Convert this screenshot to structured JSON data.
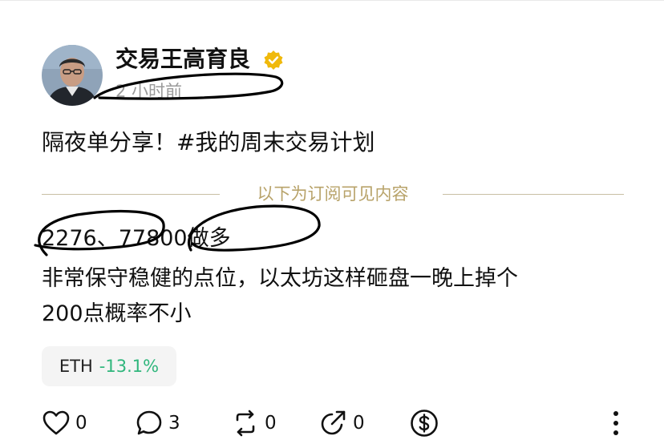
{
  "post": {
    "author": "交易王高育良",
    "timestamp": "2 小时前",
    "title": "隔夜单分享！#我的周末交易计划",
    "divider_text": "以下为订阅可见内容",
    "body_lines": [
      "2276、77800做多",
      "非常保守稳健的点位，以太坊这样砸盘一晚上掉个",
      "200点概率不小"
    ]
  },
  "ticker": {
    "symbol": "ETH",
    "change": "-13.1%"
  },
  "actions": {
    "likes": "0",
    "comments": "3",
    "reposts": "0",
    "shares": "0"
  },
  "colors": {
    "ticker_change": "#2fb67c",
    "divider_text": "#b8a36a",
    "verified_badge": "#f0b90b"
  }
}
